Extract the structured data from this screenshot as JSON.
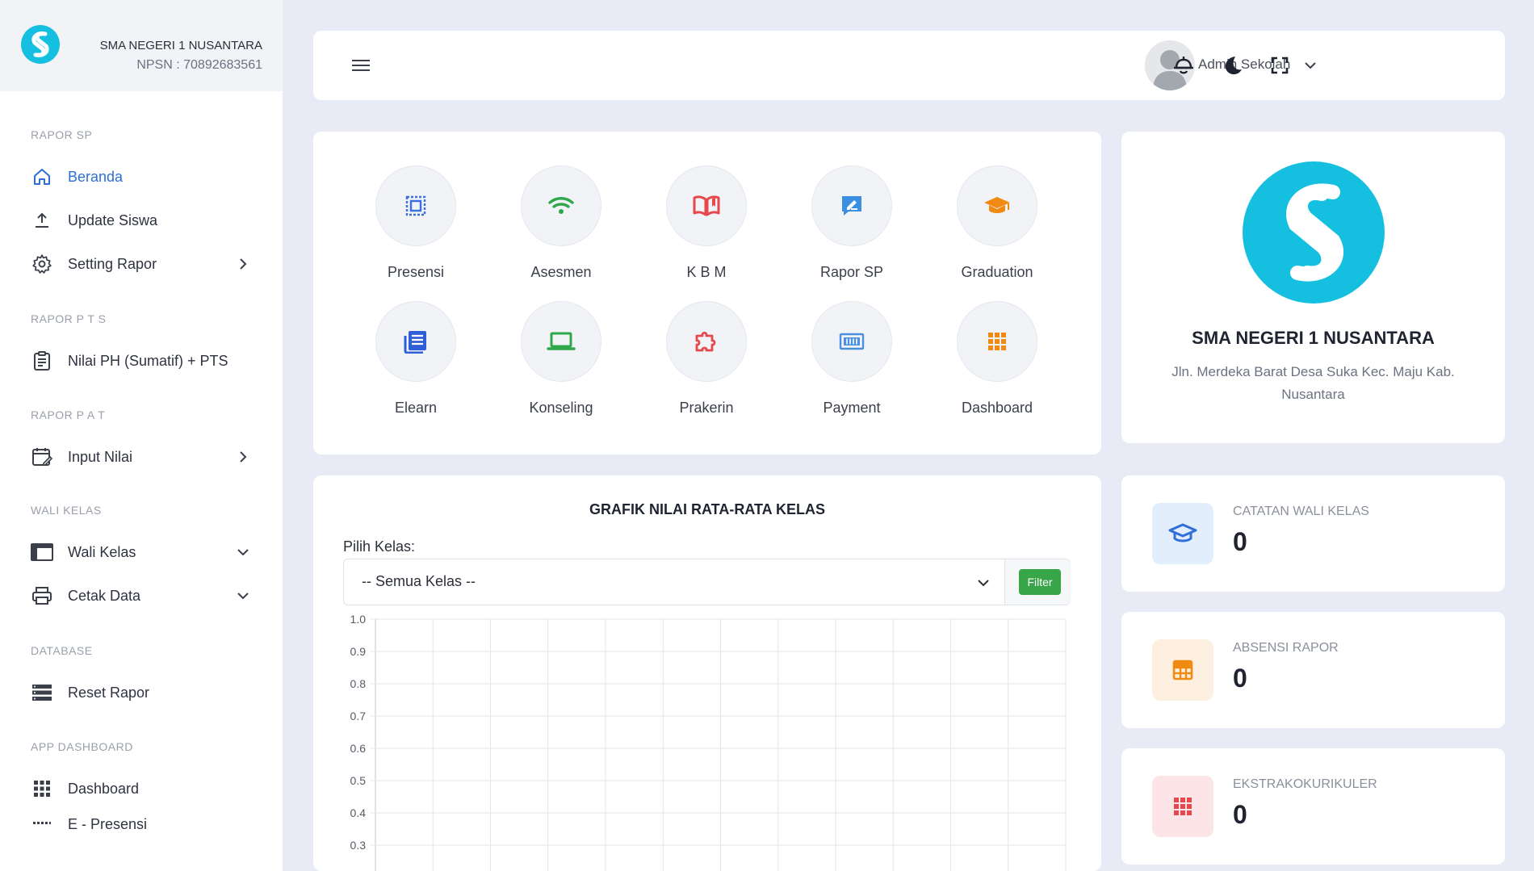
{
  "brand": {
    "name": "SMA NEGERI 1 NUSANTARA",
    "npsn": "NPSN : 70892683561"
  },
  "sidebar": {
    "sections": [
      {
        "title": "RAPOR SP"
      },
      {
        "title": "RAPOR P T S"
      },
      {
        "title": "RAPOR P A T"
      },
      {
        "title": "WALI KELAS"
      },
      {
        "title": "DATABASE"
      },
      {
        "title": "APP DASHBOARD"
      }
    ],
    "items": [
      {
        "label": "Beranda",
        "icon": "home-icon",
        "active": true
      },
      {
        "label": "Update Siswa",
        "icon": "upload-icon"
      },
      {
        "label": "Setting Rapor",
        "icon": "gear-icon",
        "chevron": "right"
      },
      {
        "label": "Nilai PH (Sumatif) + PTS",
        "icon": "clipboard-icon"
      },
      {
        "label": "Input Nilai",
        "icon": "calendar-edit-icon",
        "chevron": "right"
      },
      {
        "label": "Wali Kelas",
        "icon": "window-icon",
        "chevron": "down"
      },
      {
        "label": "Cetak Data",
        "icon": "printer-icon",
        "chevron": "down"
      },
      {
        "label": "Reset Rapor",
        "icon": "server-icon"
      },
      {
        "label": "Dashboard",
        "icon": "grid-icon"
      },
      {
        "label": "E - Presensi",
        "icon": "dots-icon"
      }
    ]
  },
  "topbar": {
    "user_name": "Admin Sekolah"
  },
  "apps": [
    {
      "label": "Presensi",
      "icon": "frame-icon",
      "color": "#3b6fe0"
    },
    {
      "label": "Asesmen",
      "icon": "wifi-icon",
      "color": "#2ea84a"
    },
    {
      "label": "K B M",
      "icon": "book-icon",
      "color": "#e5484d"
    },
    {
      "label": "Rapor SP",
      "icon": "pen-board-icon",
      "color": "#3b8fe0"
    },
    {
      "label": "Graduation",
      "icon": "graduation-cap-icon",
      "color": "#f08a12"
    },
    {
      "label": "Elearn",
      "icon": "news-icon",
      "color": "#2f5fd8"
    },
    {
      "label": "Konseling",
      "icon": "laptop-icon",
      "color": "#2ea84a"
    },
    {
      "label": "Prakerin",
      "icon": "puzzle-icon",
      "color": "#e5484d"
    },
    {
      "label": "Payment",
      "icon": "meter-icon",
      "color": "#4a8fe0"
    },
    {
      "label": "Dashboard",
      "icon": "apps-grid-icon",
      "color": "#f08a12"
    }
  ],
  "school": {
    "name": "SMA NEGERI 1 NUSANTARA",
    "address": "Jln. Merdeka Barat Desa Suka Kec. Maju Kab. Nusantara"
  },
  "chart_section": {
    "pilih_label": "Pilih Kelas:",
    "select_value": "-- Semua Kelas --",
    "filter_label": "Filter"
  },
  "chart_data": {
    "type": "bar",
    "title": "GRAFIK NILAI RATA-RATA KELAS",
    "categories": [],
    "values": [],
    "ylim": [
      0,
      1.0
    ],
    "y_ticks": [
      "1.0",
      "0.9",
      "0.8",
      "0.7",
      "0.6",
      "0.5",
      "0.4",
      "0.3"
    ],
    "grid": true
  },
  "stats": [
    {
      "label": "CATATAN WALI KELAS",
      "value": "0",
      "icon": "graduation-cap-icon",
      "color": "#2f6fd8",
      "bg": "#e3eefc"
    },
    {
      "label": "ABSENSI RAPOR",
      "value": "0",
      "icon": "table-icon",
      "color": "#f08a12",
      "bg": "#fdf0e0"
    },
    {
      "label": "EKSTRAKOKURIKULER",
      "value": "0",
      "icon": "apps-grid-icon",
      "color": "#e5484d",
      "bg": "#fde4e6"
    }
  ]
}
